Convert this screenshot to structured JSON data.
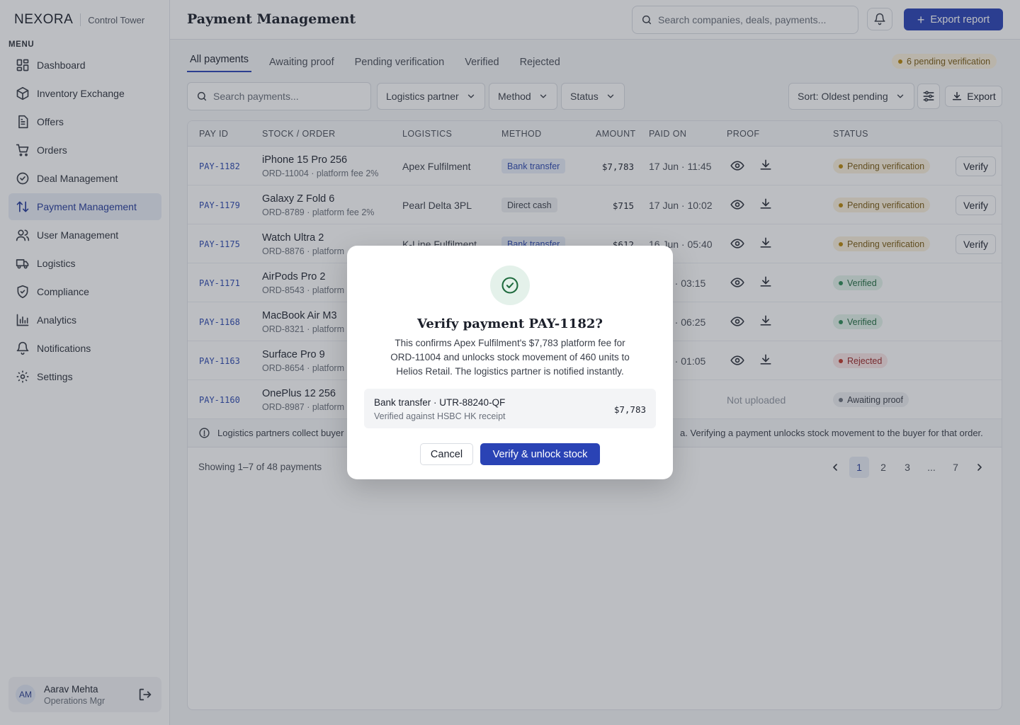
{
  "brand": {
    "name": "NEXORA",
    "subtitle": "Control Tower"
  },
  "sidebar": {
    "menu_label": "MENU",
    "items": [
      {
        "label": "Dashboard",
        "icon": "dashboard-icon"
      },
      {
        "label": "Inventory Exchange",
        "icon": "box-icon"
      },
      {
        "label": "Offers",
        "icon": "document-icon"
      },
      {
        "label": "Orders",
        "icon": "cart-icon"
      },
      {
        "label": "Deal Management",
        "icon": "check-circle-icon"
      },
      {
        "label": "Payment Management",
        "icon": "arrows-updown-icon",
        "active": true
      },
      {
        "label": "User Management",
        "icon": "users-icon"
      },
      {
        "label": "Logistics",
        "icon": "truck-icon"
      },
      {
        "label": "Compliance",
        "icon": "shield-check-icon"
      },
      {
        "label": "Analytics",
        "icon": "bar-chart-icon"
      },
      {
        "label": "Notifications",
        "icon": "bell-icon"
      },
      {
        "label": "Settings",
        "icon": "gear-icon"
      }
    ],
    "user": {
      "initials": "AM",
      "name": "Aarav Mehta",
      "role": "Operations Mgr"
    }
  },
  "header": {
    "title": "Payment Management",
    "search_placeholder": "Search companies, deals, payments...",
    "export_label": "Export report"
  },
  "tabs": [
    {
      "label": "All payments",
      "active": true
    },
    {
      "label": "Awaiting proof"
    },
    {
      "label": "Pending verification"
    },
    {
      "label": "Verified"
    },
    {
      "label": "Rejected"
    }
  ],
  "pending_badge": "6 pending verification",
  "filters": {
    "search_placeholder": "Search payments...",
    "logistics": "Logistics partner",
    "method": "Method",
    "status": "Status",
    "sort": "Sort: Oldest pending",
    "export": "Export"
  },
  "table": {
    "columns": [
      "PAY ID",
      "STOCK / ORDER",
      "LOGISTICS",
      "METHOD",
      "AMOUNT",
      "PAID ON",
      "PROOF",
      "STATUS"
    ],
    "rows": [
      {
        "id": "PAY-1182",
        "product": "iPhone 15 Pro 256",
        "order": "ORD-11004 · platform fee 2%",
        "logistics": "Apex Fulfilment",
        "method": "Bank transfer",
        "method_type": "bank",
        "amount": "$7,783",
        "paid_on": "17 Jun · 11:45",
        "proof": true,
        "status": "Pending verification",
        "status_type": "pending",
        "action": "Verify"
      },
      {
        "id": "PAY-1179",
        "product": "Galaxy Z Fold 6",
        "order": "ORD-8789 · platform fee 2%",
        "logistics": "Pearl Delta 3PL",
        "method": "Direct cash",
        "method_type": "cash",
        "amount": "$715",
        "paid_on": "17 Jun · 10:02",
        "proof": true,
        "status": "Pending verification",
        "status_type": "pending",
        "action": "Verify"
      },
      {
        "id": "PAY-1175",
        "product": "Watch Ultra 2",
        "order": "ORD-8876 · platform",
        "logistics": "K-Line Fulfilment",
        "method": "Bank transfer",
        "method_type": "bank",
        "amount": "$612",
        "paid_on": "16 Jun · 05:40",
        "proof": true,
        "status": "Pending verification",
        "status_type": "pending",
        "action": "Verify"
      },
      {
        "id": "PAY-1171",
        "product": "AirPods Pro 2",
        "order": "ORD-8543 · platform",
        "logistics": "",
        "method": "",
        "method_type": "",
        "amount": "",
        "paid_on": "n · 03:15",
        "proof": true,
        "status": "Verified",
        "status_type": "verified",
        "action": ""
      },
      {
        "id": "PAY-1168",
        "product": "MacBook Air M3",
        "order": "ORD-8321 · platform",
        "logistics": "",
        "method": "",
        "method_type": "",
        "amount": "",
        "paid_on": "n · 06:25",
        "proof": true,
        "status": "Verified",
        "status_type": "verified",
        "action": ""
      },
      {
        "id": "PAY-1163",
        "product": "Surface Pro 9",
        "order": "ORD-8654 · platform",
        "logistics": "",
        "method": "",
        "method_type": "",
        "amount": "",
        "paid_on": "n · 01:05",
        "proof": true,
        "status": "Rejected",
        "status_type": "rejected",
        "action": ""
      },
      {
        "id": "PAY-1160",
        "product": "OnePlus 12 256",
        "order": "ORD-8987 · platform",
        "logistics": "",
        "method": "",
        "method_type": "",
        "amount": "",
        "paid_on": "",
        "proof": false,
        "proof_text": "Not uploaded",
        "status": "Awaiting proof",
        "status_type": "awaiting",
        "action": ""
      }
    ],
    "notice_left": "Logistics partners collect buyer",
    "notice_right": "a. Verifying a payment unlocks stock movement to the buyer for that order.",
    "showing": "Showing 1–7 of 48 payments",
    "pages": [
      "1",
      "2",
      "3",
      "...",
      "7"
    ]
  },
  "modal": {
    "title": "Verify payment PAY-1182?",
    "body": "This confirms Apex Fulfilment's $7,783 platform fee for ORD-11004 and unlocks stock movement of 460 units to Helios Retail. The logistics partner is notified instantly.",
    "receipt_title": "Bank transfer · UTR-88240-QF",
    "receipt_sub": "Verified against HSBC HK receipt",
    "receipt_amount": "$7,783",
    "cancel": "Cancel",
    "confirm": "Verify & unlock stock"
  },
  "colors": {
    "accent": "#2a43b5",
    "pending": "#b8860b",
    "verified": "#2e8b57",
    "rejected": "#c0392b",
    "awaiting": "#6a707b"
  }
}
